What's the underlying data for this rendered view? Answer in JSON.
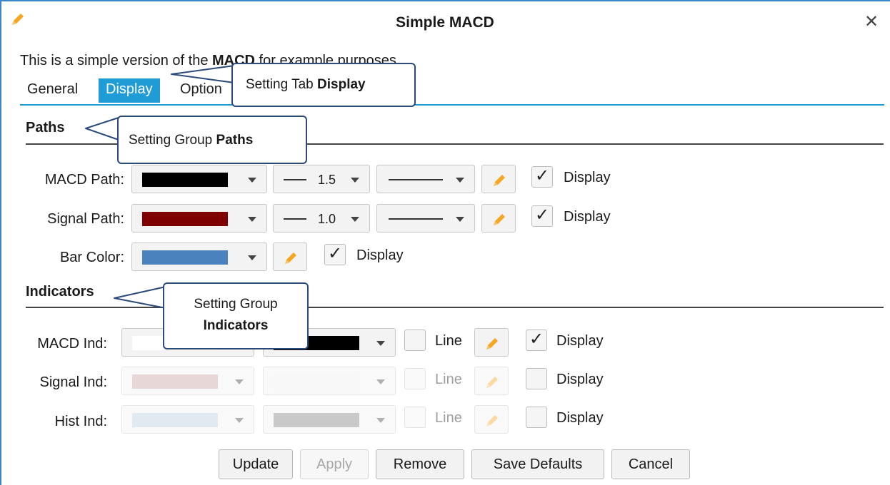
{
  "window": {
    "title": "Simple MACD",
    "close": "✕"
  },
  "description": {
    "prefix": "This is a simple version of the ",
    "bold": "MACD",
    "suffix": " for example purposes."
  },
  "tabs": [
    {
      "label": "General",
      "active": false
    },
    {
      "label": "Display",
      "active": true
    },
    {
      "label": "Option",
      "active": false
    }
  ],
  "groups": {
    "paths": "Paths",
    "indicators": "Indicators"
  },
  "paths": [
    {
      "label": "MACD Path:",
      "color": "#000000",
      "width": "1.5",
      "display": "Display",
      "checked": true
    },
    {
      "label": "Signal Path:",
      "color": "#7f0000",
      "width": "1.0",
      "display": "Display",
      "checked": true
    },
    {
      "label": "Bar Color:",
      "color": "#4a82bd",
      "display": "Display",
      "checked": true
    }
  ],
  "indicators": [
    {
      "label": "MACD Ind:",
      "color1": "#ffffff",
      "color2": "#000000",
      "line": "Line",
      "display": "Display",
      "checked": true,
      "enabled": true
    },
    {
      "label": "Signal Ind:",
      "color1": "#c9a1a1",
      "color2": "#f0f0f0",
      "line": "Line",
      "display": "Display",
      "checked": false,
      "enabled": false
    },
    {
      "label": "Hist Ind:",
      "color1": "#b9cde0",
      "color2": "#808080",
      "line": "Line",
      "display": "Display",
      "checked": false,
      "enabled": false
    }
  ],
  "buttons": {
    "update": "Update",
    "apply": "Apply",
    "remove": "Remove",
    "save_defaults": "Save Defaults",
    "cancel": "Cancel"
  },
  "callouts": {
    "tab": {
      "text": "Setting Tab ",
      "bold": "Display"
    },
    "paths": {
      "text": "Setting Group ",
      "bold": "Paths"
    },
    "indicators": {
      "line1": "Setting Group",
      "bold": "Indicators"
    }
  },
  "colors": {
    "accent": "#1f9bd6",
    "pencil": "#f5a623",
    "callout_border": "#2b4a7a"
  }
}
